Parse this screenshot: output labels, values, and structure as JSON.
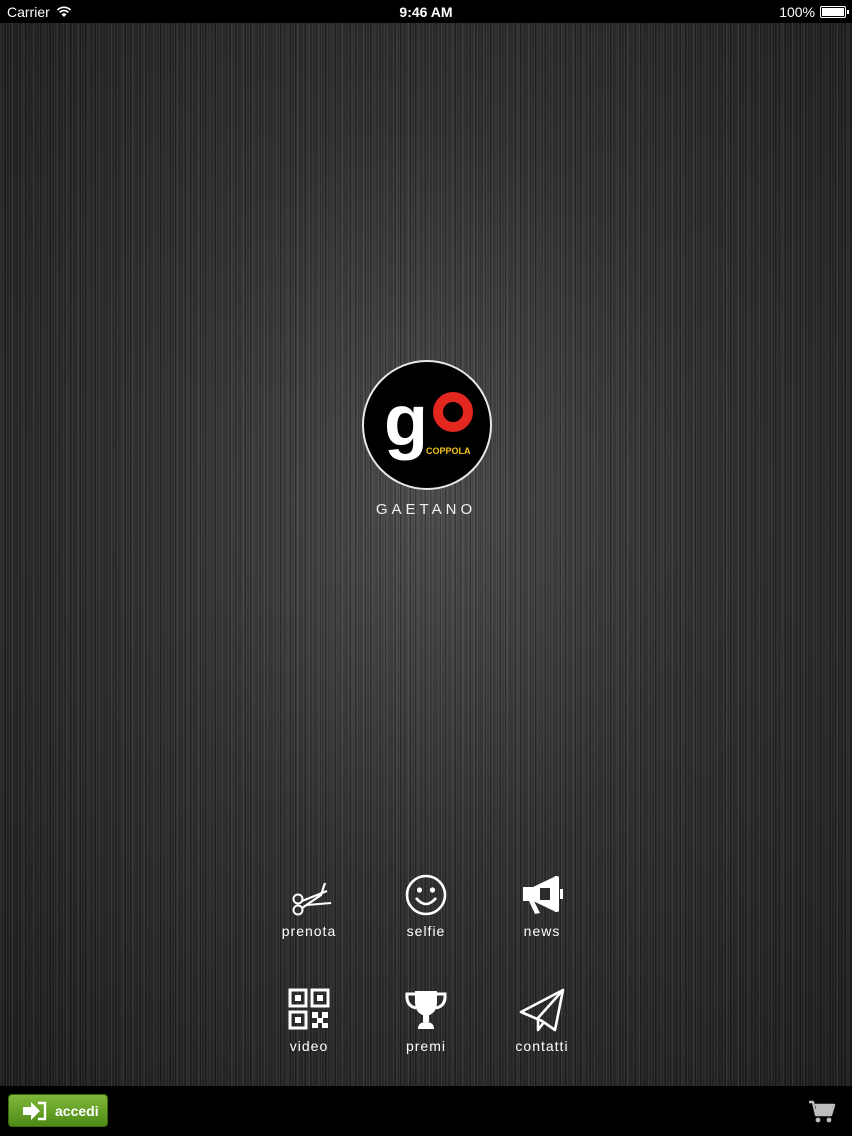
{
  "status_bar": {
    "carrier": "Carrier",
    "time": "9:46 AM",
    "battery": "100%"
  },
  "brand": {
    "logo_text": "go",
    "logo_subtext": "COPPOLA",
    "name": "GAETANO",
    "colors": {
      "logo_red": "#e3261e",
      "logo_yellow": "#f5c518"
    }
  },
  "menu": {
    "items": [
      {
        "label": "prenota",
        "icon": "scissors-icon"
      },
      {
        "label": "selfie",
        "icon": "smiley-icon"
      },
      {
        "label": "news",
        "icon": "megaphone-icon"
      },
      {
        "label": "video",
        "icon": "qr-code-icon"
      },
      {
        "label": "premi",
        "icon": "trophy-icon"
      },
      {
        "label": "contatti",
        "icon": "paper-plane-icon"
      }
    ]
  },
  "bottom_bar": {
    "login_label": "accedi",
    "login_color": "#5e9e22",
    "cart_icon": "cart-icon"
  }
}
